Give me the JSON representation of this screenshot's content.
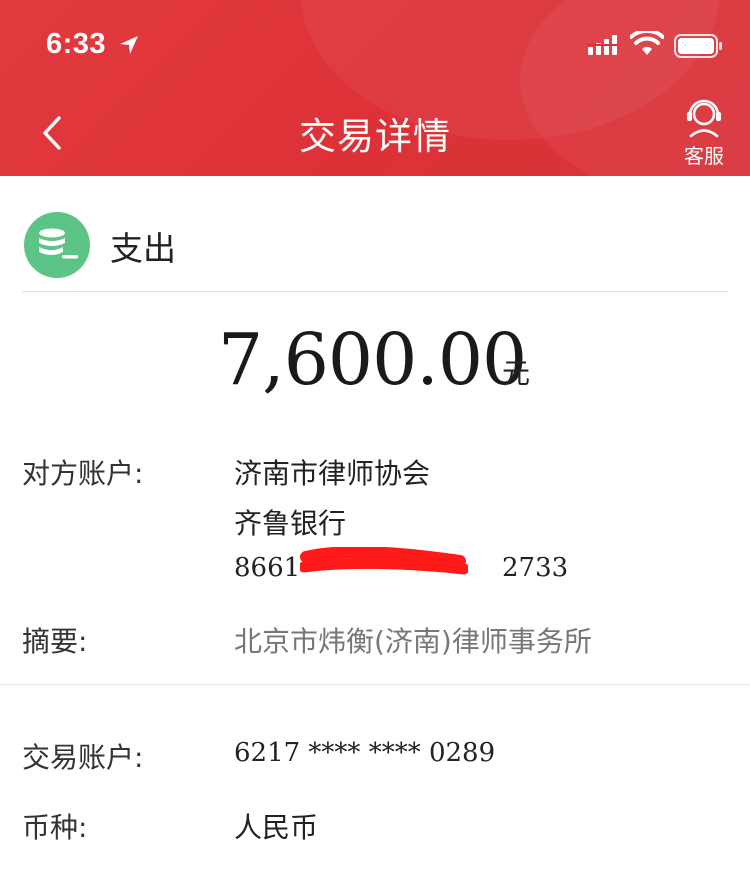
{
  "status_bar": {
    "time": "6:33"
  },
  "nav": {
    "title": "交易详情",
    "service_label": "客服"
  },
  "transaction": {
    "type_label": "支出",
    "amount": "7,600.00",
    "currency_unit": "元"
  },
  "details": {
    "counterparty_label": "对方账户:",
    "counterparty_name": "济南市律师协会",
    "counterparty_bank": "齐鲁银行",
    "counterparty_account_start": "8661",
    "counterparty_account_end": "2733",
    "summary_label": "摘要:",
    "summary_value": "北京市炜衡(济南)律师事务所",
    "account_label": "交易账户:",
    "account_value": "6217 **** **** 0289",
    "currency_label": "币种:",
    "currency_value": "人民币"
  },
  "colors": {
    "header_red": "#dc3137",
    "income_green": "#5cc486"
  },
  "icons": {
    "back": "chevron-left-icon",
    "service": "customer-service-icon",
    "type": "coins-icon"
  }
}
